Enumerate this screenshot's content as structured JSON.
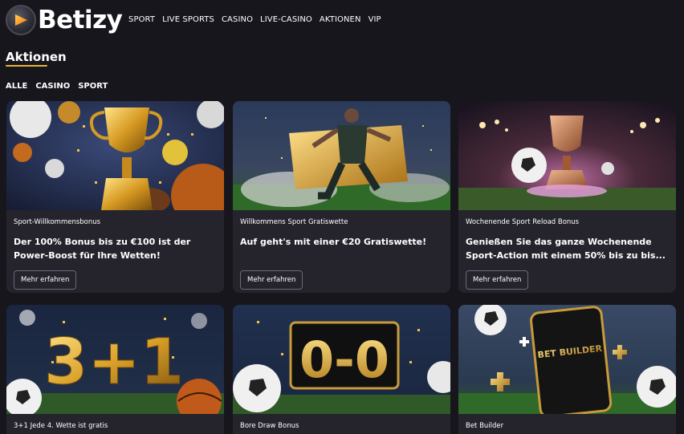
{
  "header": {
    "logo_text": "Betizy",
    "nav": [
      "SPORT",
      "LIVE SPORTS",
      "CASINO",
      "LIVE-CASINO",
      "AKTIONEN",
      "VIP"
    ]
  },
  "page": {
    "title": "Aktionen",
    "accent_color": "#e8b33a",
    "filters": [
      "ALLE",
      "CASINO",
      "SPORT"
    ]
  },
  "cards": [
    {
      "category": "Sport-Willkommensbonus",
      "title": "Der 100% Bonus bis zu €100 ist der Power-Boost für Ihre Wetten!",
      "button": "Mehr erfahren",
      "image": "golden-trophy-with-sports-balls"
    },
    {
      "category": "Willkommens Sport Gratiswette",
      "title": "Auf geht's mit einer €20 Gratiswette!",
      "button": "Mehr erfahren",
      "image": "footballer-kicking-with-golden-ticket"
    },
    {
      "category": "Wochenende Sport Reload Bonus",
      "title": "Genießen Sie das ganze Wochenende Sport-Action mit einem 50% bis zu bis...",
      "button": "Mehr erfahren",
      "image": "trophy-and-football-in-stadium"
    },
    {
      "category": "3+1 Jede 4. Wette ist gratis",
      "image": "golden-3-plus-1-with-balls",
      "image_text": "3+1"
    },
    {
      "category": "Bore Draw Bonus",
      "image": "scoreboard-0-0-with-footballs",
      "image_text": "0-0"
    },
    {
      "category": "Bet Builder",
      "image": "phone-bet-builder-with-footballs",
      "image_text": "BET BUILDER"
    }
  ]
}
